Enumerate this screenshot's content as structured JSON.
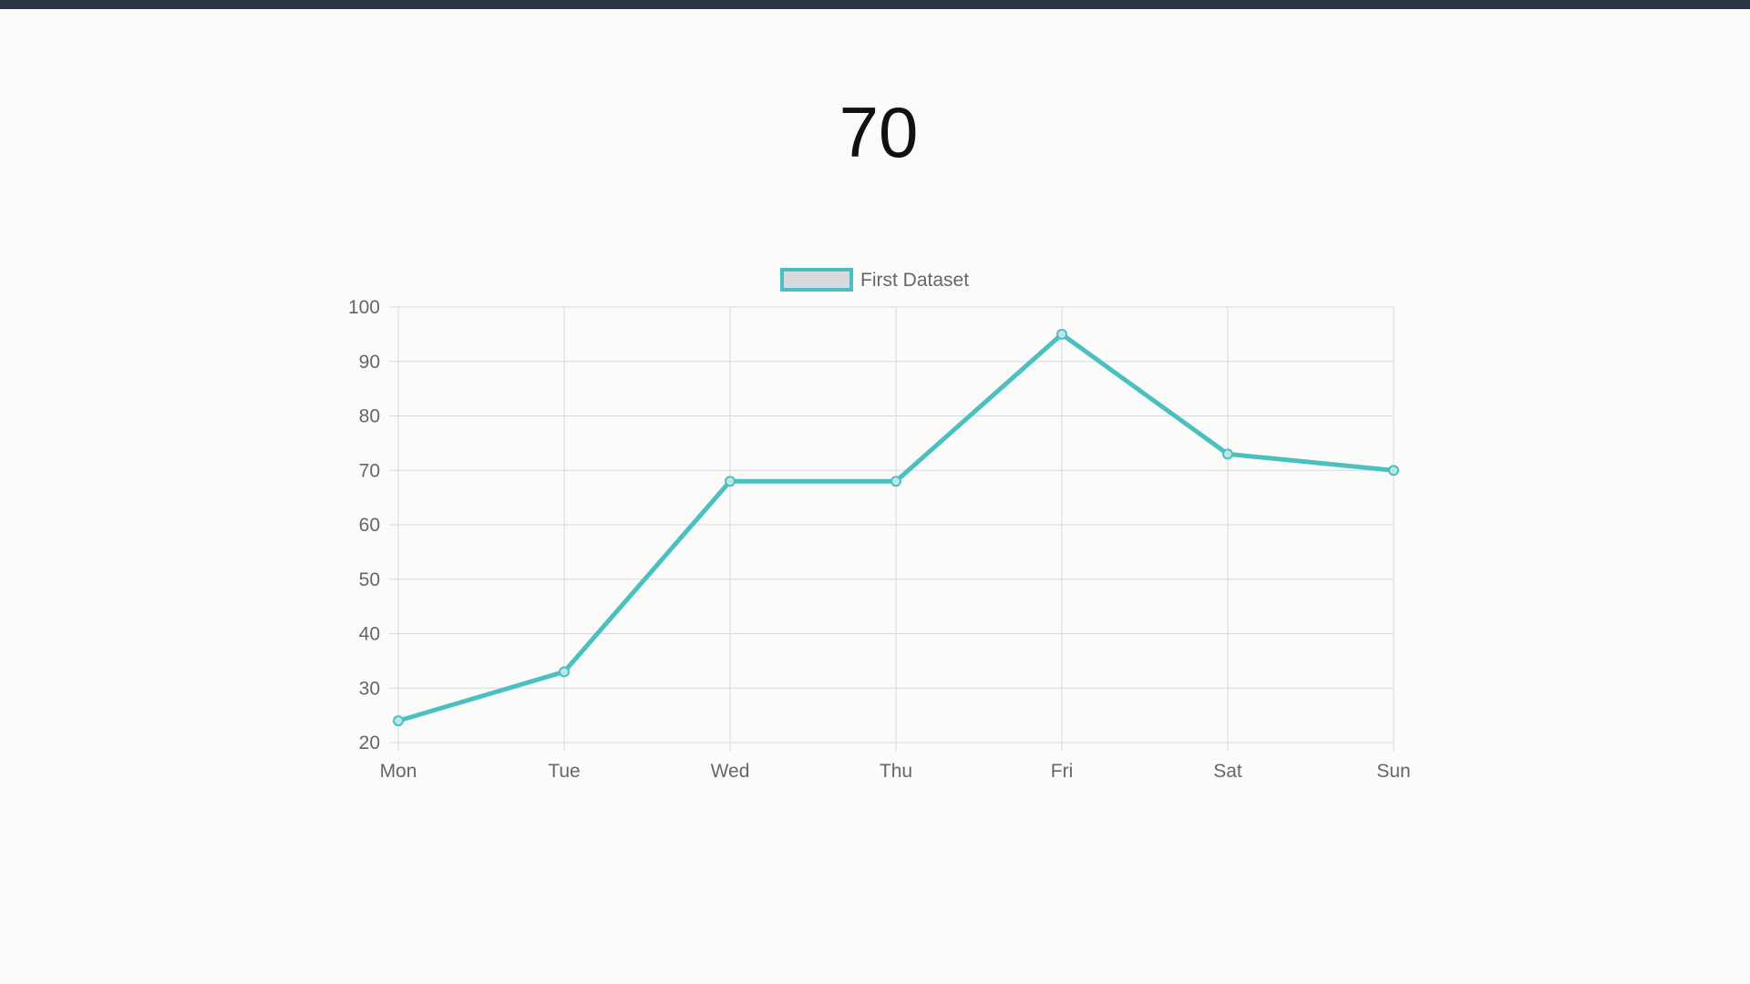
{
  "header": {
    "value": "70"
  },
  "colors": {
    "top_bar": "#2b3442",
    "line": "#4bc0c0",
    "legend_fill": "#d9dadb",
    "grid": "#d6d9e4",
    "tick_text": "#666666",
    "background": "#fbfbfa"
  },
  "chart_data": {
    "type": "line",
    "categories": [
      "Mon",
      "Tue",
      "Wed",
      "Thu",
      "Fri",
      "Sat",
      "Sun"
    ],
    "series": [
      {
        "name": "First Dataset",
        "values": [
          24,
          33,
          68,
          68,
          95,
          73,
          70
        ]
      }
    ],
    "ylim": [
      20,
      100
    ],
    "yticks": [
      100,
      90,
      80,
      70,
      60,
      50,
      40,
      30,
      20
    ],
    "grid": true,
    "legend": "top-center"
  }
}
